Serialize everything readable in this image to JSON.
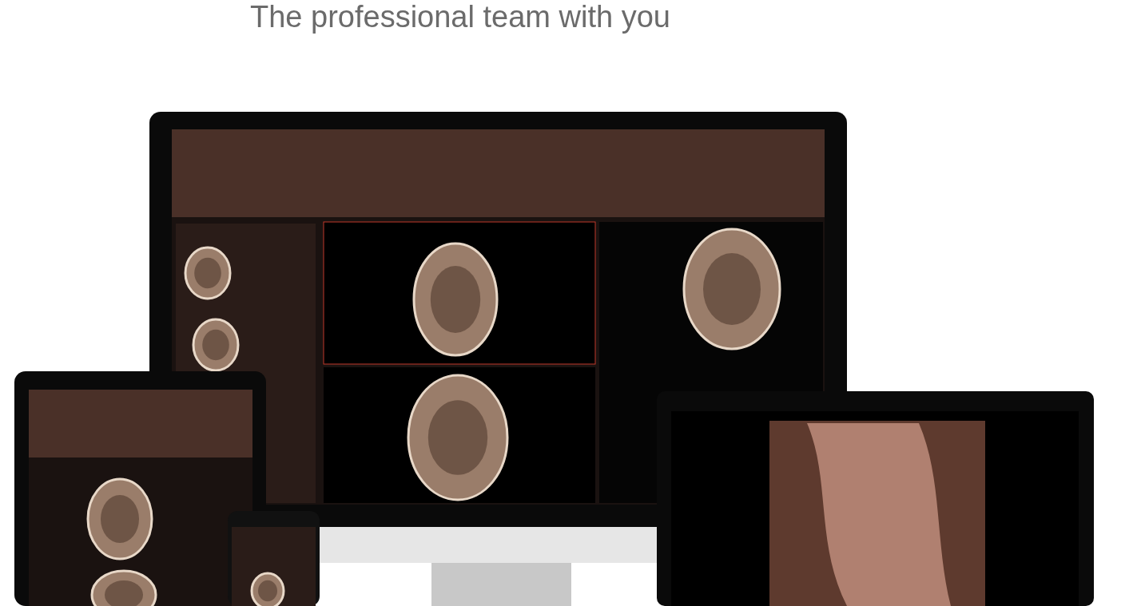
{
  "heading": {
    "text": "The professional team with you"
  }
}
